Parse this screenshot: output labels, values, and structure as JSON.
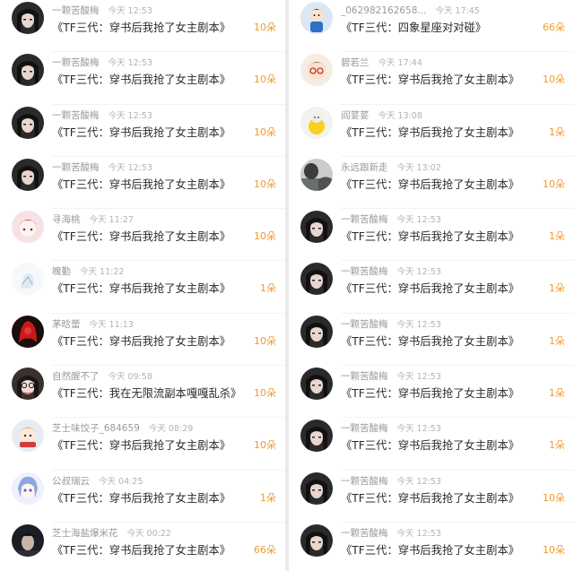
{
  "left": [
    {
      "avatar": "avatar-girl-dark-hair",
      "user": "一颗苦酸梅",
      "time": "今天 12:53",
      "message": "《TF三代：穿书后我抢了女主剧本》",
      "count": "10朵"
    },
    {
      "avatar": "avatar-girl-dark-hair",
      "user": "一颗苦酸梅",
      "time": "今天 12:53",
      "message": "《TF三代：穿书后我抢了女主剧本》",
      "count": "10朵"
    },
    {
      "avatar": "avatar-girl-dark-hair",
      "user": "一颗苦酸梅",
      "time": "今天 12:53",
      "message": "《TF三代：穿书后我抢了女主剧本》",
      "count": "10朵"
    },
    {
      "avatar": "avatar-girl-dark-hair",
      "user": "一颗苦酸梅",
      "time": "今天 12:53",
      "message": "《TF三代：穿书后我抢了女主剧本》",
      "count": "10朵"
    },
    {
      "avatar": "avatar-pink-cartoon",
      "user": "寻海桃",
      "time": "今天 11:27",
      "message": "《TF三代：穿书后我抢了女主剧本》",
      "count": "10朵"
    },
    {
      "avatar": "avatar-white-sketch",
      "user": "魄勤",
      "time": "今天 11:22",
      "message": "《TF三代：穿书后我抢了女主剧本》",
      "count": "1朵"
    },
    {
      "avatar": "avatar-red-dark",
      "user": "茅晗蕾",
      "time": "今天 11:13",
      "message": "《TF三代：穿书后我抢了女主剧本》",
      "count": "10朵"
    },
    {
      "avatar": "avatar-girl-glasses",
      "user": "自然醒不了",
      "time": "今天 09:58",
      "message": "《TF三代：我在无限流副本嘎嘎乱杀》",
      "count": "10朵"
    },
    {
      "avatar": "avatar-anime-scarf",
      "user": "芝士味饺子_684659",
      "time": "今天 08:29",
      "message": "《TF三代：穿书后我抢了女主剧本》",
      "count": "10朵"
    },
    {
      "avatar": "avatar-anime-blue",
      "user": "公叔瑞云",
      "time": "今天 04:25",
      "message": "《TF三代：穿书后我抢了女主剧本》",
      "count": "1朵"
    },
    {
      "avatar": "avatar-dark-boy",
      "user": "芝士海盐爆米花",
      "time": "今天 00:22",
      "message": "《TF三代：穿书后我抢了女主剧本》",
      "count": "66朵"
    }
  ],
  "right": [
    {
      "avatar": "avatar-cartoon-boy",
      "user": "_062982162658...",
      "time": "今天 17:45",
      "message": "《TF三代：四象星座对对碰》",
      "count": "66朵"
    },
    {
      "avatar": "avatar-cartoon-glasses",
      "user": "碧若兰",
      "time": "今天 17:44",
      "message": "《TF三代：穿书后我抢了女主剧本》",
      "count": "10朵"
    },
    {
      "avatar": "avatar-yellow-plush",
      "user": "阎荽荽",
      "time": "今天 13:08",
      "message": "《TF三代：穿书后我抢了女主剧本》",
      "count": "1朵"
    },
    {
      "avatar": "avatar-grey-scene",
      "user": "永远跟新走",
      "time": "今天 13:02",
      "message": "《TF三代：穿书后我抢了女主剧本》",
      "count": "10朵"
    },
    {
      "avatar": "avatar-girl-dark-hair",
      "user": "一颗苦酸梅",
      "time": "今天 12:53",
      "message": "《TF三代：穿书后我抢了女主剧本》",
      "count": "1朵"
    },
    {
      "avatar": "avatar-girl-dark-hair",
      "user": "一颗苦酸梅",
      "time": "今天 12:53",
      "message": "《TF三代：穿书后我抢了女主剧本》",
      "count": "1朵"
    },
    {
      "avatar": "avatar-girl-dark-hair",
      "user": "一颗苦酸梅",
      "time": "今天 12:53",
      "message": "《TF三代：穿书后我抢了女主剧本》",
      "count": "1朵"
    },
    {
      "avatar": "avatar-girl-dark-hair",
      "user": "一颗苦酸梅",
      "time": "今天 12:53",
      "message": "《TF三代：穿书后我抢了女主剧本》",
      "count": "1朵"
    },
    {
      "avatar": "avatar-girl-dark-hair",
      "user": "一颗苦酸梅",
      "time": "今天 12:53",
      "message": "《TF三代：穿书后我抢了女主剧本》",
      "count": "1朵"
    },
    {
      "avatar": "avatar-girl-dark-hair",
      "user": "一颗苦酸梅",
      "time": "今天 12:53",
      "message": "《TF三代：穿书后我抢了女主剧本》",
      "count": "10朵"
    },
    {
      "avatar": "avatar-girl-dark-hair",
      "user": "一颗苦酸梅",
      "time": "今天 12:53",
      "message": "《TF三代：穿书后我抢了女主剧本》",
      "count": "10朵"
    }
  ],
  "colors": {
    "count": "#f39a28",
    "username": "#9a9a9a",
    "message": "#2b2b2b"
  }
}
